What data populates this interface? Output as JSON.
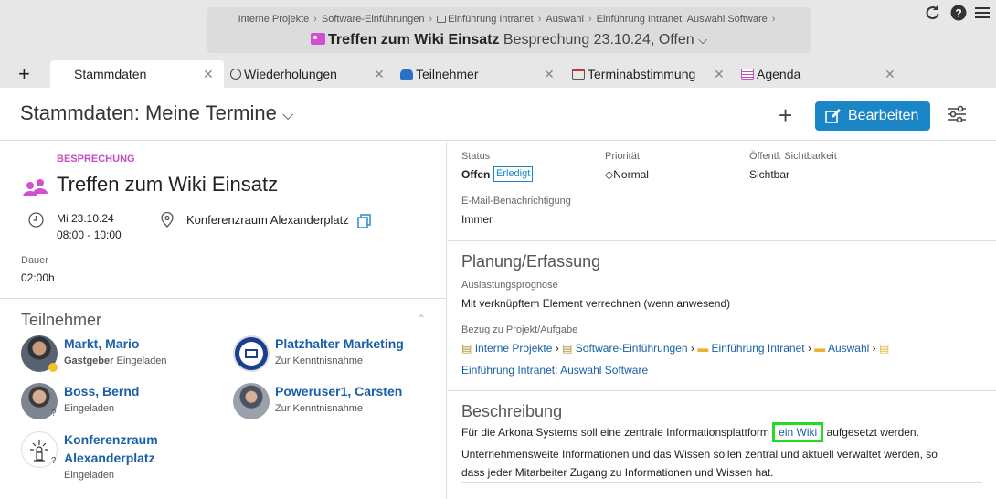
{
  "topbar": {
    "breadcrumbs": [
      "Interne Projekte",
      "Software-Einführungen",
      "Einführung Intranet",
      "Auswahl",
      "Einführung Intranet: Auswahl Software"
    ],
    "title_bold": "Treffen zum Wiki Einsatz",
    "title_sub": "Besprechung 23.10.24, Offen",
    "icons": [
      "refresh-icon",
      "help-icon",
      "menu-icon"
    ]
  },
  "tabs": [
    {
      "label": "Stammdaten",
      "icon": "meeting-icon"
    },
    {
      "label": "Wiederholungen",
      "icon": "repeat-icon"
    },
    {
      "label": "Teilnehmer",
      "icon": "participants-icon"
    },
    {
      "label": "Terminabstimmung",
      "icon": "calendar-icon"
    },
    {
      "label": "Agenda",
      "icon": "agenda-icon"
    }
  ],
  "header": {
    "title": "Stammdaten: Meine Termine",
    "edit_label": "Bearbeiten"
  },
  "event": {
    "type": "BESPRECHUNG",
    "title": "Treffen zum Wiki Einsatz",
    "date": "Mi 23.10.24",
    "time": "08:00 - 10:00",
    "location": "Konferenzraum Alexanderplatz",
    "duration_label": "Dauer",
    "duration": "02:00h"
  },
  "participants": {
    "title": "Teilnehmer",
    "items": [
      {
        "name": "Markt, Mario",
        "role_bold": "Gastgeber",
        "role": "Eingeladen"
      },
      {
        "name": "Platzhalter Marketing",
        "role_bold": "",
        "role": "Zur Kenntnisnahme"
      },
      {
        "name": "Boss, Bernd",
        "role_bold": "",
        "role": "Eingeladen"
      },
      {
        "name": "Poweruser1, Carsten",
        "role_bold": "",
        "role": "Zur Kenntnisnahme"
      },
      {
        "name_line1": "Konferenzraum",
        "name_line2": "Alexanderplatz",
        "role_bold": "",
        "role": "Eingeladen"
      }
    ]
  },
  "status": {
    "status_label": "Status",
    "status_value": "Offen",
    "status_badge": "Erledigt",
    "priority_label": "Priorität",
    "priority_value": "Normal",
    "visibility_label": "Öffentl. Sichtbarkeit",
    "visibility_value": "Sichtbar",
    "email_label": "E-Mail-Benachrichtigung",
    "email_value": "Immer"
  },
  "planning": {
    "title": "Planung/Erfassung",
    "forecast_label": "Auslastungsprognose",
    "forecast_value": "Mit verknüpftem Element verrechnen (wenn anwesend)",
    "ref_label": "Bezug zu Projekt/Aufgabe",
    "refs": [
      "Interne Projekte",
      "Software-Einführungen",
      "Einführung Intranet",
      "Auswahl"
    ],
    "ref_last": "Einführung Intranet: Auswahl Software"
  },
  "description": {
    "title": "Beschreibung",
    "pre": "Für die Arkona Systems soll eine zentrale Informationsplattform",
    "link": "ein Wiki",
    "post": "aufgesetzt werden.",
    "line2": "Unternehmensweite Informationen und das Wissen sollen zentral und aktuell verwaltet werden, so",
    "line3": "dass jeder Mitarbeiter Zugang zu Informationen und Wissen hat."
  },
  "colors": {
    "accent": "#1a86c6",
    "meeting": "#d14fd1",
    "highlight": "#22dd22"
  }
}
